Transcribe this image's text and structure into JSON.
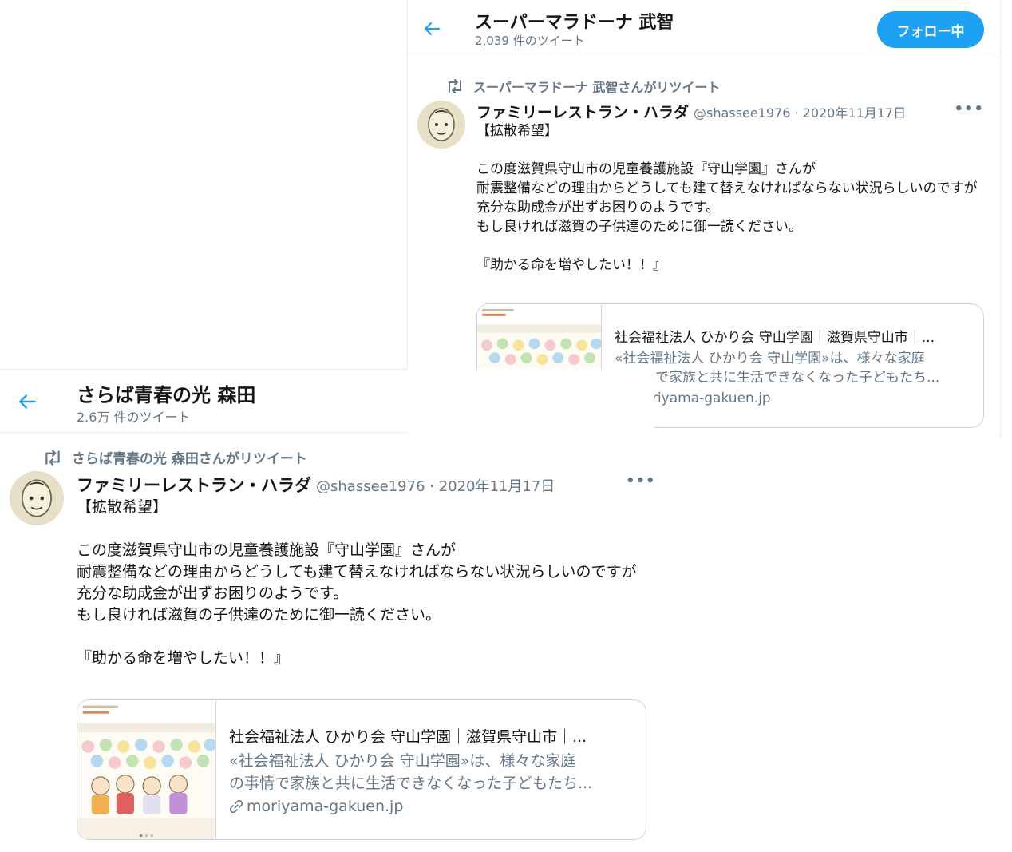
{
  "colors": {
    "accent": "#1da1f2",
    "text": "#14171a",
    "secondary": "#657786",
    "border": "#ccd6dd"
  },
  "panel_a": {
    "header": {
      "title": "スーパーマラドーナ 武智",
      "tweet_count": "2,039 件のツイート",
      "follow_label": "フォロー中"
    },
    "retweet_label": "スーパーマラドーナ 武智さんがリツイート",
    "tweet": {
      "author": "ファミリーレストラン・ハラダ",
      "handle": "@shassee1976 · 2020年11月17日",
      "body": "【拡散希望】\n\nこの度滋賀県守山市の児童養護施設『守山学園』さんが\n耐震整備などの理由からどうしても建て替えなければならない状況らしいのですが\n充分な助成金が出ずお困りのようです。\nもし良ければ滋賀の子供達のために御一読ください。\n\n『助かる命を増やしたい！！』",
      "more": "•••"
    },
    "card": {
      "title": "社会福祉法人 ひかり会 守山学園｜滋賀県守山市｜...",
      "desc_line1": "«社会福祉法人 ひかり会 守山学園»は、様々な家庭",
      "desc_line2": "の事情で家族と共に生活できなくなった子どもたち...",
      "domain": "moriyama-gakuen.jp"
    }
  },
  "panel_b": {
    "header": {
      "title": "さらば青春の光 森田",
      "tweet_count": "2.6万 件のツイート"
    },
    "retweet_label": "さらば青春の光 森田さんがリツイート",
    "tweet": {
      "author": "ファミリーレストラン・ハラダ",
      "handle": "@shassee1976 · 2020年11月17日",
      "body": "【拡散希望】\n\nこの度滋賀県守山市の児童養護施設『守山学園』さんが\n耐震整備などの理由からどうしても建て替えなければならない状況らしいのですが\n充分な助成金が出ずお困りのようです。\nもし良ければ滋賀の子供達のために御一読ください。\n\n『助かる命を増やしたい！！』",
      "more": "•••"
    },
    "card": {
      "title": "社会福祉法人 ひかり会 守山学園｜滋賀県守山市｜...",
      "desc_line1": "«社会福祉法人 ひかり会 守山学園»は、様々な家庭",
      "desc_line2": "の事情で家族と共に生活できなくなった子どもたち...",
      "domain": "moriyama-gakuen.jp"
    }
  }
}
